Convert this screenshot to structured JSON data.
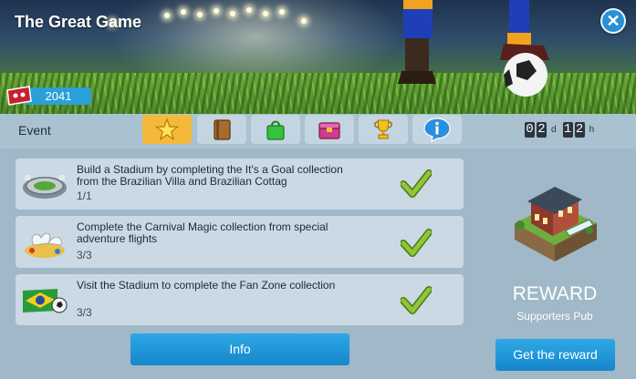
{
  "window": {
    "title": "The Great Game",
    "close_icon": "close-icon"
  },
  "tickets": {
    "count": "2041",
    "icon": "ticket-icon"
  },
  "event_bar": {
    "label": "Event",
    "tabs": [
      {
        "icon": "star-icon",
        "active": true
      },
      {
        "icon": "book-icon",
        "active": false
      },
      {
        "icon": "shopping-bag-icon",
        "active": false
      },
      {
        "icon": "chest-icon",
        "active": false
      },
      {
        "icon": "trophy-icon",
        "active": false
      },
      {
        "icon": "info-icon",
        "active": false
      }
    ],
    "timer": {
      "days_d1": "0",
      "days_d2": "2",
      "days_unit": "d",
      "hours_d1": "1",
      "hours_d2": "2",
      "hours_unit": "h"
    }
  },
  "tasks": [
    {
      "icon": "stadium-icon",
      "description": "Build a Stadium by completing the It's a Goal collection from the Brazilian Villa and Brazilian Cottag",
      "progress": "1/1",
      "completed": true
    },
    {
      "icon": "carnival-doves-icon",
      "description": "Complete the Carnival Magic collection from special adventure flights",
      "progress": "3/3",
      "completed": true
    },
    {
      "icon": "brazil-flag-ball-icon",
      "description": "Visit the Stadium to complete the Fan Zone collection",
      "progress": "3/3",
      "completed": true
    }
  ],
  "info_button": {
    "label": "Info"
  },
  "reward": {
    "title": "REWARD",
    "name": "Supporters Pub",
    "image": "supporters-pub-building-icon",
    "button_label": "Get the reward"
  },
  "colors": {
    "accent_blue": "#1e96dc",
    "active_tab": "#f4b93b",
    "check_green": "#7ab52a",
    "panel_bg": "#a0b8c8"
  }
}
